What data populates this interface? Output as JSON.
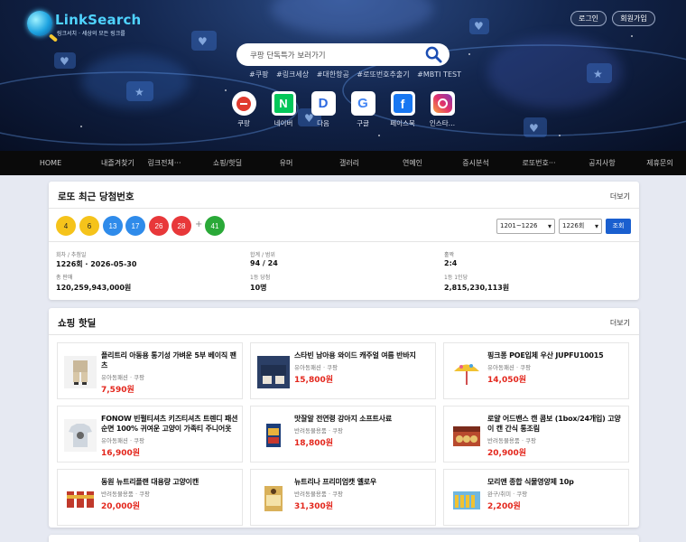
{
  "header": {
    "logo_name": "LinkSearch",
    "logo_tagline": "링크서치 · 세상의 모든 링크를",
    "login": "로그인",
    "signup": "회원가입",
    "search_placeholder": "쿠팡 단독특가 보러가기",
    "hashtags": [
      "#쿠팡",
      "#링크세상",
      "#대한항공",
      "#로또번호추출기",
      "#MBTI TEST"
    ],
    "portals": [
      {
        "label": "쿠팡",
        "icon": "coupang-icon"
      },
      {
        "label": "네이버",
        "icon": "naver-icon"
      },
      {
        "label": "다음",
        "icon": "daum-icon"
      },
      {
        "label": "구글",
        "icon": "google-icon"
      },
      {
        "label": "페이스북",
        "icon": "facebook-icon"
      },
      {
        "label": "인스타…",
        "icon": "instagram-icon"
      }
    ]
  },
  "nav": [
    "HOME",
    "내즐겨찾기",
    "링크전체···",
    "쇼핑/핫딜",
    "유머",
    "갤러리",
    "연예인",
    "증시분석",
    "로또번호···",
    "공지사항",
    "제휴문의"
  ],
  "lotto": {
    "title": "로또 최근 당첨번호",
    "more": "더보기",
    "numbers": [
      4,
      6,
      13,
      17,
      26,
      28
    ],
    "plus": "+",
    "bonus": 41,
    "ball_colors": {
      "yellow": "#f5c31b",
      "blue": "#2f8bea",
      "red": "#e8383a",
      "green": "#2aa938"
    },
    "range_select": "1201~1226",
    "round_select": "1226회",
    "query_button": "조회",
    "stats": [
      {
        "label": "회차 / 추첨일",
        "value": "1226회 · 2026-05-30"
      },
      {
        "label": "합계 / 범위",
        "value": "94 / 24"
      },
      {
        "label": "홀짝",
        "value": "2:4"
      },
      {
        "label": "총 판매",
        "value": "120,259,943,000원"
      },
      {
        "label": "1등 당첨",
        "value": "10명"
      },
      {
        "label": "1등 1인당",
        "value": "2,815,230,113원"
      }
    ]
  },
  "shopping": {
    "title": "쇼핑 핫딜",
    "more": "더보기",
    "items": [
      {
        "name": "플리트리 아동용 통기성 가벼운 5부 베이직 팬츠",
        "category": "유아동패션 · 쿠팡",
        "price": "7,590원"
      },
      {
        "name": "스타빈 남아용 와이드 캐주얼 여름 반바지",
        "category": "유아동패션 · 쿠팡",
        "price": "15,800원"
      },
      {
        "name": "핑크퐁 POE입체 우산 JUPFU10015",
        "category": "유아동패션 · 쿠팡",
        "price": "14,050원"
      },
      {
        "name": "FONOW 빈펄티셔츠 키즈티셔츠 트렌디 패션 순면 100% 귀여운 고양이 가족티 주니어옷",
        "category": "유아동패션 · 쿠팡",
        "price": "16,900원"
      },
      {
        "name": "맛잘알 전연령 강아지 소프트사료",
        "category": "반려동물용품 · 쿠팡",
        "price": "18,800원"
      },
      {
        "name": "로얄 어드밴스 캔 콤보 (1box/24개입) 고양이 캔 간식 통조림",
        "category": "반려동물용품 · 쿠팡",
        "price": "20,900원"
      },
      {
        "name": "동원 뉴트리플랜 대용량 고양이캔",
        "category": "반려동물용품 · 쿠팡",
        "price": "20,000원"
      },
      {
        "name": "뉴트리나 프리미엄캣 옐로우",
        "category": "반려동물용품 · 쿠팡",
        "price": "31,300원"
      },
      {
        "name": "모리앤 종합 식물영양제 10p",
        "category": "완구/취미 · 쿠팡",
        "price": "2,200원"
      }
    ]
  }
}
